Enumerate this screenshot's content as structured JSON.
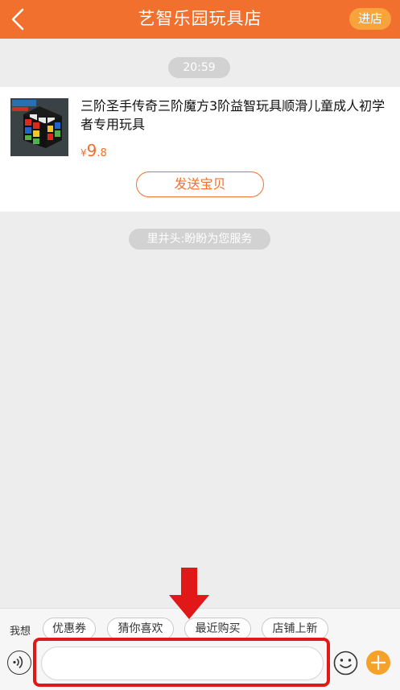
{
  "header": {
    "title": "艺智乐园玩具店",
    "store_button": "进店",
    "back_icon": "chevron-left-icon",
    "background": "#f2702d"
  },
  "chat": {
    "timestamp": "20:59",
    "product": {
      "title": "三阶圣手传奇三阶魔方3阶益智玩具顺滑儿童成人初学者专用玩具",
      "price_symbol": "¥",
      "price_integer": "9",
      "price_decimal": ".8",
      "send_button": "发送宝贝"
    },
    "service_notice": "里井头:盼盼为您服务"
  },
  "quick_replies": {
    "label": "我想",
    "chips": [
      "优惠券",
      "猜你喜欢",
      "最近购买",
      "店铺上新"
    ]
  },
  "input_bar": {
    "message_value": "",
    "voice_icon": "voice-icon",
    "emoji_icon": "emoji-icon",
    "plus_icon": "plus-icon"
  },
  "annotation": {
    "arrow_icon": "down-arrow-icon",
    "color": "#e01818"
  }
}
